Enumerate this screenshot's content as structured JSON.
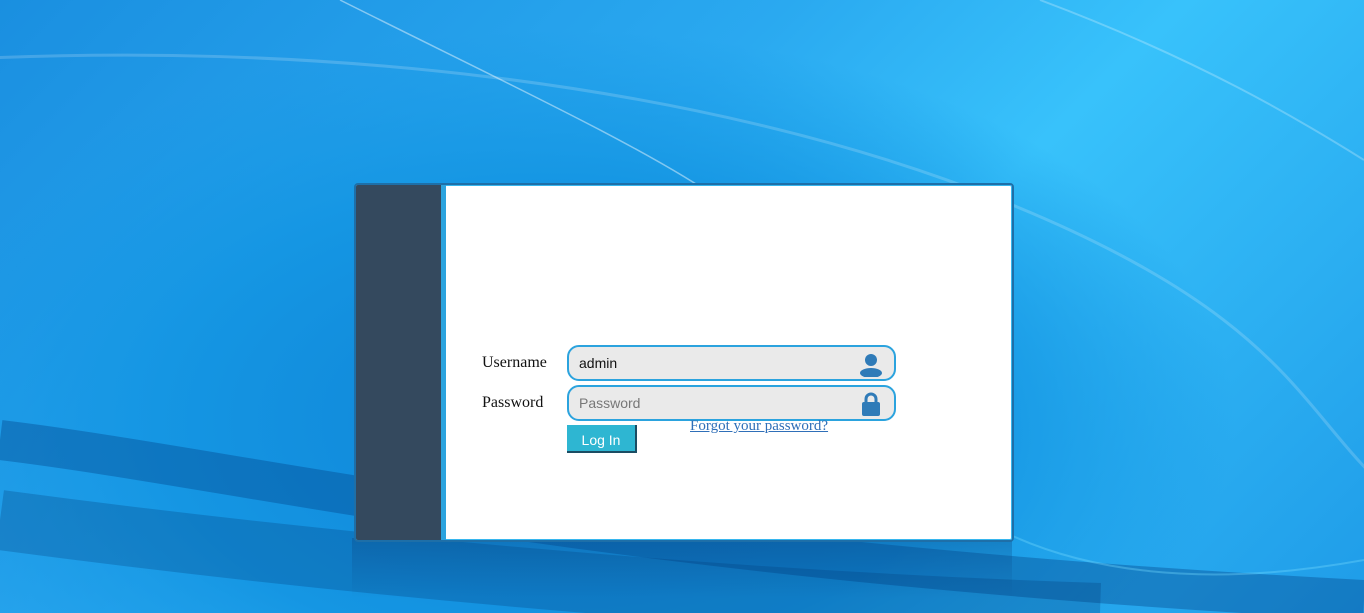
{
  "login": {
    "username_label": "Username",
    "username_value": "admin",
    "password_label": "Password",
    "password_placeholder": "Password",
    "login_button": "Log In",
    "forgot_link": "Forgot your password?"
  },
  "icons": {
    "username_icon": "user-icon",
    "password_icon": "lock-icon"
  },
  "colors": {
    "sidebar": "#34495e",
    "accent": "#2ba3de",
    "button": "#2eb6d2",
    "link": "#2f6fb8",
    "background": "#1a9be6"
  }
}
